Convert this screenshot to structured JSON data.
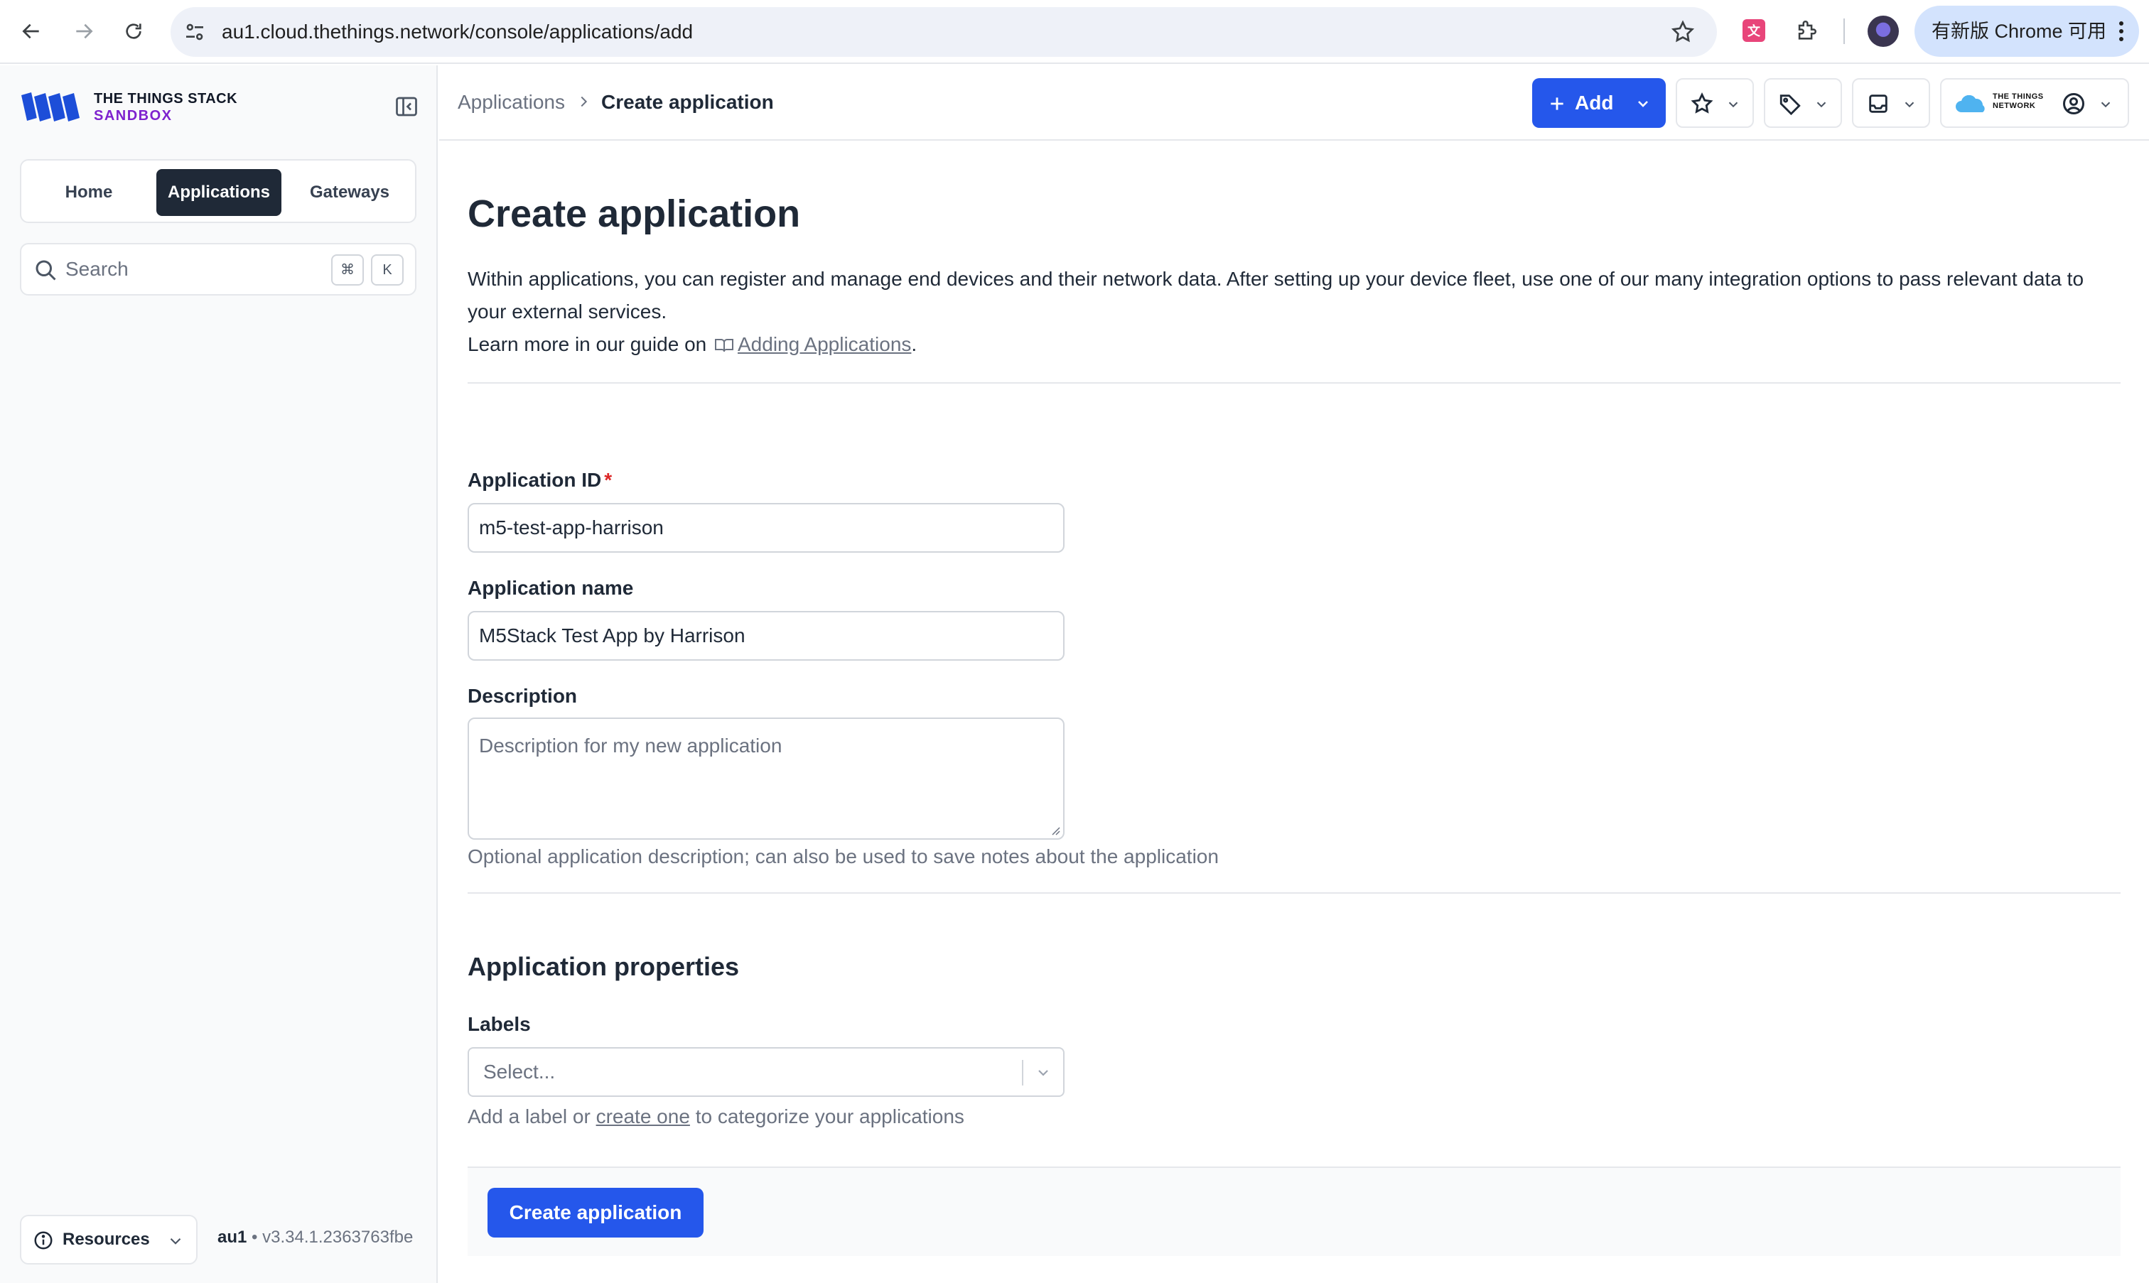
{
  "browser": {
    "url": "au1.cloud.thethings.network/console/applications/add",
    "update_label": "有新版 Chrome 可用"
  },
  "sidebar": {
    "brand_line1": "THE THINGS STACK",
    "brand_line2": "SANDBOX",
    "tabs": [
      {
        "label": "Home",
        "active": false
      },
      {
        "label": "Applications",
        "active": true
      },
      {
        "label": "Gateways",
        "active": false
      }
    ],
    "search": {
      "placeholder": "Search",
      "shortcut_keys": [
        "⌘",
        "K"
      ]
    },
    "resources_label": "Resources",
    "cluster": "au1",
    "version": "v3.34.1.2363763fbe"
  },
  "header": {
    "breadcrumb": [
      "Applications",
      "Create application"
    ],
    "add_label": "Add",
    "account_brand": [
      "THE THINGS",
      "NETWORK"
    ]
  },
  "page": {
    "title": "Create application",
    "intro": "Within applications, you can register and manage end devices and their network data. After setting up your device fleet, use one of our many integration options to pass relevant data to your external services.",
    "learn_prefix": "Learn more in our guide on",
    "learn_link": "Adding Applications",
    "learn_suffix": "."
  },
  "form": {
    "app_id": {
      "label": "Application ID",
      "required_mark": "*",
      "value": "m5-test-app-harrison"
    },
    "app_name": {
      "label": "Application name",
      "value": "M5Stack Test App by Harrison"
    },
    "description": {
      "label": "Description",
      "placeholder": "Description for my new application",
      "hint": "Optional application description; can also be used to save notes about the application"
    },
    "properties_title": "Application properties",
    "labels": {
      "label": "Labels",
      "placeholder": "Select...",
      "hint_prefix": "Add a label or",
      "hint_link": "create one",
      "hint_suffix": "to categorize your applications"
    },
    "submit_label": "Create application"
  },
  "colors": {
    "primary": "#2557eb",
    "active_tab": "#1f2937",
    "required": "#dc2626",
    "brand_accent": "#7e22ce",
    "logo_blue": "#1d4ed8"
  }
}
